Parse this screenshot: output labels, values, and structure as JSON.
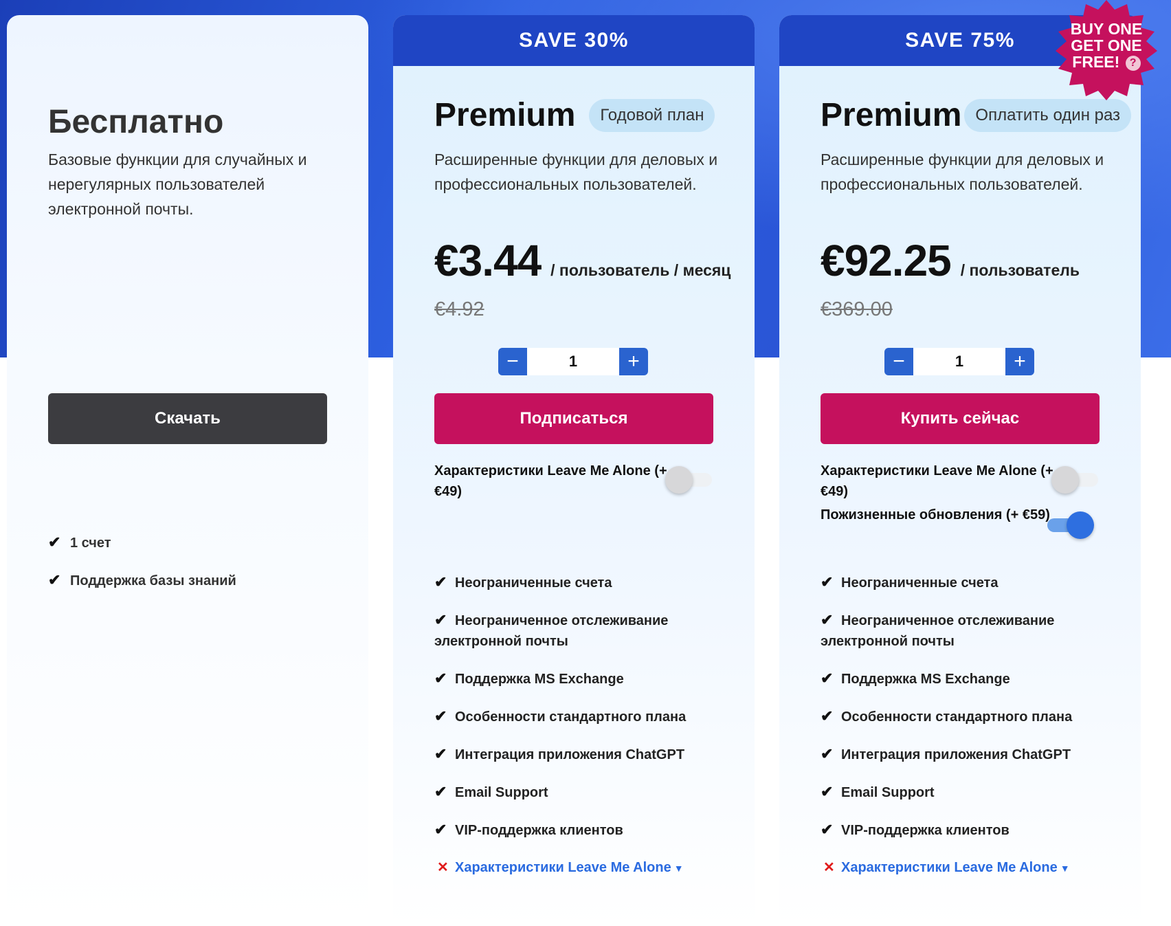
{
  "colors": {
    "header_blue": "#1f45c4",
    "cta_pink": "#c5115d",
    "cta_dark": "#3c3c40",
    "link_blue": "#2a6be0",
    "cross_red": "#e01b1b",
    "burst": "#c5115d"
  },
  "free": {
    "title": "Бесплатно",
    "description": "Базовые функции для случайных и нерегулярных пользователей электронной почты.",
    "cta": "Скачать",
    "features": [
      "1 счет",
      "Поддержка базы знаний"
    ]
  },
  "annual": {
    "banner": "SAVE 30%",
    "title": "Premium",
    "pill": "Годовой план",
    "description": "Расширенные функции для деловых и профессиональных пользователей.",
    "price": "€3.44",
    "per": "/ пользователь / месяц",
    "old_price": "€4.92",
    "quantity": "1",
    "minus": "−",
    "plus": "+",
    "cta": "Подписаться",
    "addons": [
      {
        "label": "Характеристики Leave Me Alone (+€49)",
        "enabled": false
      }
    ],
    "features": [
      "Неограниченные счета",
      "Неограниченное отслеживание электронной почты",
      "Поддержка MS Exchange",
      "Особенности стандартного плана",
      "Интеграция приложения ChatGPT",
      "Email Support",
      "VIP-поддержка клиентов"
    ],
    "excluded": "Характеристики Leave Me Alone"
  },
  "lifetime": {
    "banner": "SAVE 75%",
    "badge_line1": "BUY ONE",
    "badge_line2": "GET ONE",
    "badge_line3": "FREE!",
    "badge_help": "?",
    "title": "Premium",
    "pill": "Оплатить один раз",
    "description": "Расширенные функции для деловых и профессиональных пользователей.",
    "price": "€92.25",
    "per": "/ пользователь",
    "old_price": "€369.00",
    "quantity": "1",
    "minus": "−",
    "plus": "+",
    "cta": "Купить сейчас",
    "addons": [
      {
        "label": "Характеристики Leave Me Alone (+€49)",
        "enabled": false
      },
      {
        "label": "Пожизненные обновления (+ €59)",
        "enabled": true
      }
    ],
    "features": [
      "Неограниченные счета",
      "Неограниченное отслеживание электронной почты",
      "Поддержка MS Exchange",
      "Особенности стандартного плана",
      "Интеграция приложения ChatGPT",
      "Email Support",
      "VIP-поддержка клиентов"
    ],
    "excluded": "Характеристики Leave Me Alone"
  },
  "icons": {
    "check": "check-icon",
    "cross": "cross-icon",
    "caret": "caret-down-icon"
  }
}
